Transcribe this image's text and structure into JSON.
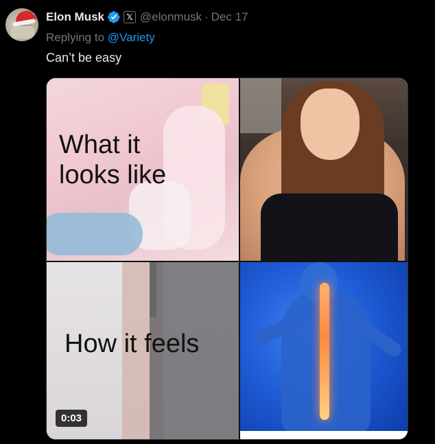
{
  "author": {
    "name": "Elon Musk",
    "handle": "@elonmusk",
    "separator": "·",
    "date": "Dec 17",
    "verified_icon": "verified-badge-icon",
    "affiliate_badge": "𝕏",
    "avatar_icon": "avatar-image"
  },
  "reply": {
    "prefix": "Replying to",
    "mention": "@Variety"
  },
  "tweet_text": "Can’t be easy",
  "media": {
    "caption_top": "What it looks like",
    "caption_bottom": "How it feels",
    "duration": "0:03"
  },
  "colors": {
    "background": "#000000",
    "primary_text": "#e7e9ea",
    "secondary_text": "#71767b",
    "link": "#1d9bf0",
    "verified": "#1d9bf0"
  }
}
